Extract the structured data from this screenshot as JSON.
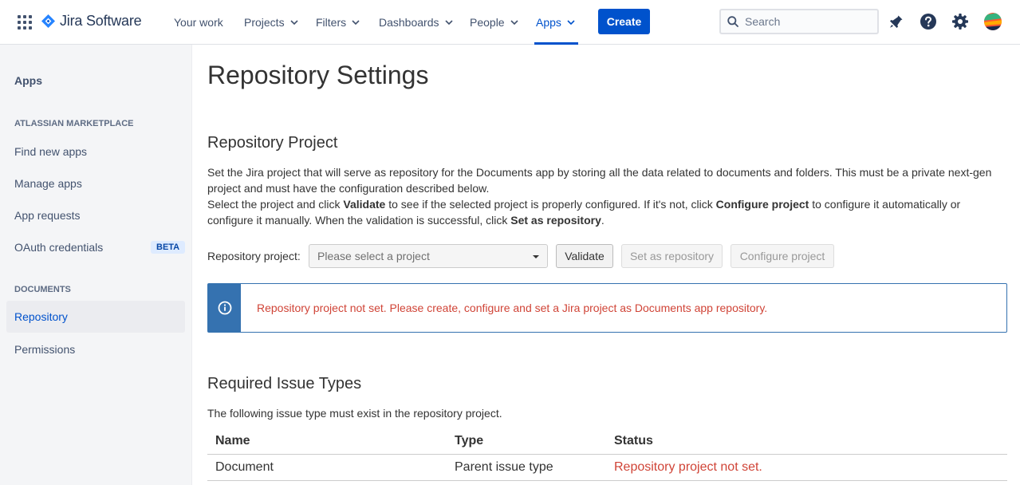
{
  "topnav": {
    "product": "Jira Software",
    "items": [
      {
        "label": "Your work",
        "dropdown": false
      },
      {
        "label": "Projects",
        "dropdown": true
      },
      {
        "label": "Filters",
        "dropdown": true
      },
      {
        "label": "Dashboards",
        "dropdown": true
      },
      {
        "label": "People",
        "dropdown": true
      },
      {
        "label": "Apps",
        "dropdown": true,
        "active": true
      }
    ],
    "create_label": "Create",
    "search_placeholder": "Search",
    "icons": [
      "notifications-icon",
      "help-icon",
      "settings-icon",
      "avatar"
    ]
  },
  "sidebar": {
    "title": "Apps",
    "sections": [
      {
        "heading": "ATLASSIAN MARKETPLACE",
        "items": [
          {
            "label": "Find new apps"
          },
          {
            "label": "Manage apps"
          },
          {
            "label": "App requests"
          },
          {
            "label": "OAuth credentials",
            "badge": "BETA"
          }
        ]
      },
      {
        "heading": "DOCUMENTS",
        "items": [
          {
            "label": "Repository",
            "selected": true
          },
          {
            "label": "Permissions"
          }
        ]
      }
    ]
  },
  "main": {
    "title": "Repository Settings",
    "repo_section": {
      "title": "Repository Project",
      "line1": "Set the Jira project that will serve as repository for the Documents app by storing all the data related to documents and folders. This must be a private next-gen project and must have the configuration described below.",
      "line2_a": "Select the project and click ",
      "line2_b": "Validate",
      "line2_c": " to see if the selected project is properly configured. If it's not, click ",
      "line2_d": "Configure project",
      "line2_e": " to configure it automatically or configure it manually. When the validation is successful, click ",
      "line2_f": "Set as repository",
      "line2_g": ".",
      "field_label": "Repository project:",
      "select_placeholder": "Please select a project",
      "validate_label": "Validate",
      "set_repo_label": "Set as repository",
      "configure_label": "Configure project",
      "alert_text": "Repository project not set. Please create, configure and set a Jira project as Documents app repository."
    },
    "issue_types": {
      "title": "Required Issue Types",
      "description": "The following issue type must exist in the repository project.",
      "columns": [
        "Name",
        "Type",
        "Status"
      ],
      "rows": [
        {
          "name": "Document",
          "type": "Parent issue type",
          "status": "Repository project not set."
        }
      ]
    }
  },
  "colors": {
    "brand": "#0052cc",
    "alert_blue": "#3572b0",
    "error_red": "#d04437"
  }
}
